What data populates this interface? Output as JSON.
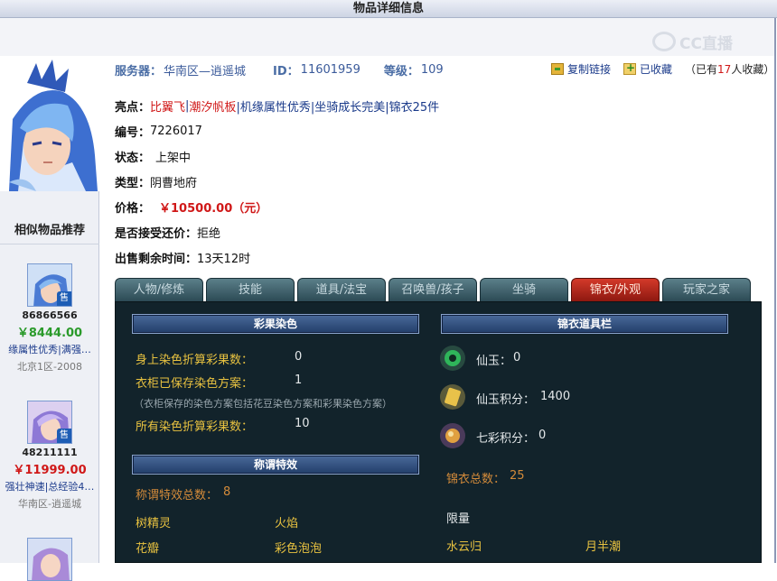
{
  "window": {
    "title": "物品详细信息"
  },
  "watermark": {
    "text": "CC直播"
  },
  "header": {
    "server_label": "服务器：",
    "server_value": "华南区—逍遥城",
    "id_label": "ID：",
    "id_value": "11601959",
    "level_label": "等级：",
    "level_value": "109",
    "copy_link": "复制链接",
    "favorited": "已收藏",
    "fav_count_pre": "（已有",
    "fav_count": "17",
    "fav_count_post": "人收藏）"
  },
  "details": {
    "highlight_label": "亮点：",
    "highlight_1": "比翼飞",
    "highlight_2": "潮汐帆板",
    "highlight_rest": "|机缘属性优秀|坐骑成长完美|锦衣25件",
    "number_label": "编号：",
    "number_value": "7226017",
    "status_label": "状态：",
    "status_value": "上架中",
    "type_label": "类型：",
    "type_value": "阴曹地府",
    "price_label": "价格：",
    "price_value": "￥10500.00（元）",
    "counteroffer_label": "是否接受还价：",
    "counteroffer_value": "拒绝",
    "remaining_label": "出售剩余时间：",
    "remaining_value": "13天12时"
  },
  "tabs": [
    "人物/修炼",
    "技能",
    "道具/法宝",
    "召唤兽/孩子",
    "坐骑",
    "锦衣/外观",
    "玩家之家"
  ],
  "active_tab": "锦衣/外观",
  "dye": {
    "header": "彩果染色",
    "body_label": "身上染色折算彩果数：",
    "body_value": "0",
    "wardrobe_label": "衣柜已保存染色方案：",
    "wardrobe_value": "1",
    "note": "（衣柜保存的染色方案包括花豆染色方案和彩果染色方案）",
    "total_label": "所有染色折算彩果数：",
    "total_value": "10"
  },
  "title_effects": {
    "header": "称谓特效",
    "count_label": "称谓特效总数：",
    "count_value": "8",
    "items": [
      "树精灵",
      "火焰",
      "花瓣",
      "彩色泡泡"
    ]
  },
  "jinyi": {
    "header": "锦衣道具栏",
    "xianyu_label": "仙玉：",
    "xianyu_value": "0",
    "points_label": "仙玉积分：",
    "points_value": "1400",
    "qicai_label": "七彩积分：",
    "qicai_value": "0",
    "total_label": "锦衣总数：",
    "total_value": "25",
    "limited_label": "限量",
    "items": [
      "水云归",
      "月半潮"
    ]
  },
  "similar": {
    "title": "相似物品推荐",
    "sale_badge": "售",
    "items": [
      {
        "id": "86866566",
        "price": "￥8444.00",
        "tags": "缘属性优秀|满强…",
        "server": "北京1区-2008"
      },
      {
        "id": "48211111",
        "price": "￥11999.00",
        "tags": "强壮神速|总经验4…",
        "server": "华南区-逍遥城"
      }
    ]
  },
  "colors": {
    "accent_red": "#d01818",
    "link_blue": "#1a3a8a",
    "panel_bg": "#12232b",
    "gold": "#e8c240"
  }
}
